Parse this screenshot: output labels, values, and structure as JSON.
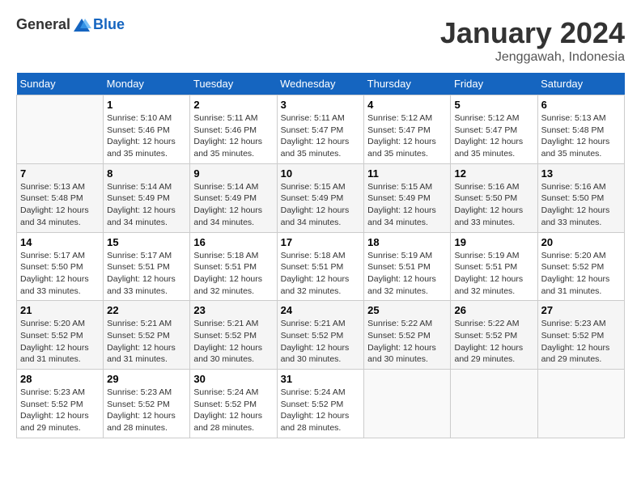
{
  "header": {
    "logo_general": "General",
    "logo_blue": "Blue",
    "month_title": "January 2024",
    "location": "Jenggawah, Indonesia"
  },
  "days_of_week": [
    "Sunday",
    "Monday",
    "Tuesday",
    "Wednesday",
    "Thursday",
    "Friday",
    "Saturday"
  ],
  "weeks": [
    [
      {
        "day": "",
        "info": ""
      },
      {
        "day": "1",
        "info": "Sunrise: 5:10 AM\nSunset: 5:46 PM\nDaylight: 12 hours\nand 35 minutes."
      },
      {
        "day": "2",
        "info": "Sunrise: 5:11 AM\nSunset: 5:46 PM\nDaylight: 12 hours\nand 35 minutes."
      },
      {
        "day": "3",
        "info": "Sunrise: 5:11 AM\nSunset: 5:47 PM\nDaylight: 12 hours\nand 35 minutes."
      },
      {
        "day": "4",
        "info": "Sunrise: 5:12 AM\nSunset: 5:47 PM\nDaylight: 12 hours\nand 35 minutes."
      },
      {
        "day": "5",
        "info": "Sunrise: 5:12 AM\nSunset: 5:47 PM\nDaylight: 12 hours\nand 35 minutes."
      },
      {
        "day": "6",
        "info": "Sunrise: 5:13 AM\nSunset: 5:48 PM\nDaylight: 12 hours\nand 35 minutes."
      }
    ],
    [
      {
        "day": "7",
        "info": "Sunrise: 5:13 AM\nSunset: 5:48 PM\nDaylight: 12 hours\nand 34 minutes."
      },
      {
        "day": "8",
        "info": "Sunrise: 5:14 AM\nSunset: 5:49 PM\nDaylight: 12 hours\nand 34 minutes."
      },
      {
        "day": "9",
        "info": "Sunrise: 5:14 AM\nSunset: 5:49 PM\nDaylight: 12 hours\nand 34 minutes."
      },
      {
        "day": "10",
        "info": "Sunrise: 5:15 AM\nSunset: 5:49 PM\nDaylight: 12 hours\nand 34 minutes."
      },
      {
        "day": "11",
        "info": "Sunrise: 5:15 AM\nSunset: 5:49 PM\nDaylight: 12 hours\nand 34 minutes."
      },
      {
        "day": "12",
        "info": "Sunrise: 5:16 AM\nSunset: 5:50 PM\nDaylight: 12 hours\nand 33 minutes."
      },
      {
        "day": "13",
        "info": "Sunrise: 5:16 AM\nSunset: 5:50 PM\nDaylight: 12 hours\nand 33 minutes."
      }
    ],
    [
      {
        "day": "14",
        "info": "Sunrise: 5:17 AM\nSunset: 5:50 PM\nDaylight: 12 hours\nand 33 minutes."
      },
      {
        "day": "15",
        "info": "Sunrise: 5:17 AM\nSunset: 5:51 PM\nDaylight: 12 hours\nand 33 minutes."
      },
      {
        "day": "16",
        "info": "Sunrise: 5:18 AM\nSunset: 5:51 PM\nDaylight: 12 hours\nand 32 minutes."
      },
      {
        "day": "17",
        "info": "Sunrise: 5:18 AM\nSunset: 5:51 PM\nDaylight: 12 hours\nand 32 minutes."
      },
      {
        "day": "18",
        "info": "Sunrise: 5:19 AM\nSunset: 5:51 PM\nDaylight: 12 hours\nand 32 minutes."
      },
      {
        "day": "19",
        "info": "Sunrise: 5:19 AM\nSunset: 5:51 PM\nDaylight: 12 hours\nand 32 minutes."
      },
      {
        "day": "20",
        "info": "Sunrise: 5:20 AM\nSunset: 5:52 PM\nDaylight: 12 hours\nand 31 minutes."
      }
    ],
    [
      {
        "day": "21",
        "info": "Sunrise: 5:20 AM\nSunset: 5:52 PM\nDaylight: 12 hours\nand 31 minutes."
      },
      {
        "day": "22",
        "info": "Sunrise: 5:21 AM\nSunset: 5:52 PM\nDaylight: 12 hours\nand 31 minutes."
      },
      {
        "day": "23",
        "info": "Sunrise: 5:21 AM\nSunset: 5:52 PM\nDaylight: 12 hours\nand 30 minutes."
      },
      {
        "day": "24",
        "info": "Sunrise: 5:21 AM\nSunset: 5:52 PM\nDaylight: 12 hours\nand 30 minutes."
      },
      {
        "day": "25",
        "info": "Sunrise: 5:22 AM\nSunset: 5:52 PM\nDaylight: 12 hours\nand 30 minutes."
      },
      {
        "day": "26",
        "info": "Sunrise: 5:22 AM\nSunset: 5:52 PM\nDaylight: 12 hours\nand 29 minutes."
      },
      {
        "day": "27",
        "info": "Sunrise: 5:23 AM\nSunset: 5:52 PM\nDaylight: 12 hours\nand 29 minutes."
      }
    ],
    [
      {
        "day": "28",
        "info": "Sunrise: 5:23 AM\nSunset: 5:52 PM\nDaylight: 12 hours\nand 29 minutes."
      },
      {
        "day": "29",
        "info": "Sunrise: 5:23 AM\nSunset: 5:52 PM\nDaylight: 12 hours\nand 28 minutes."
      },
      {
        "day": "30",
        "info": "Sunrise: 5:24 AM\nSunset: 5:52 PM\nDaylight: 12 hours\nand 28 minutes."
      },
      {
        "day": "31",
        "info": "Sunrise: 5:24 AM\nSunset: 5:52 PM\nDaylight: 12 hours\nand 28 minutes."
      },
      {
        "day": "",
        "info": ""
      },
      {
        "day": "",
        "info": ""
      },
      {
        "day": "",
        "info": ""
      }
    ]
  ]
}
